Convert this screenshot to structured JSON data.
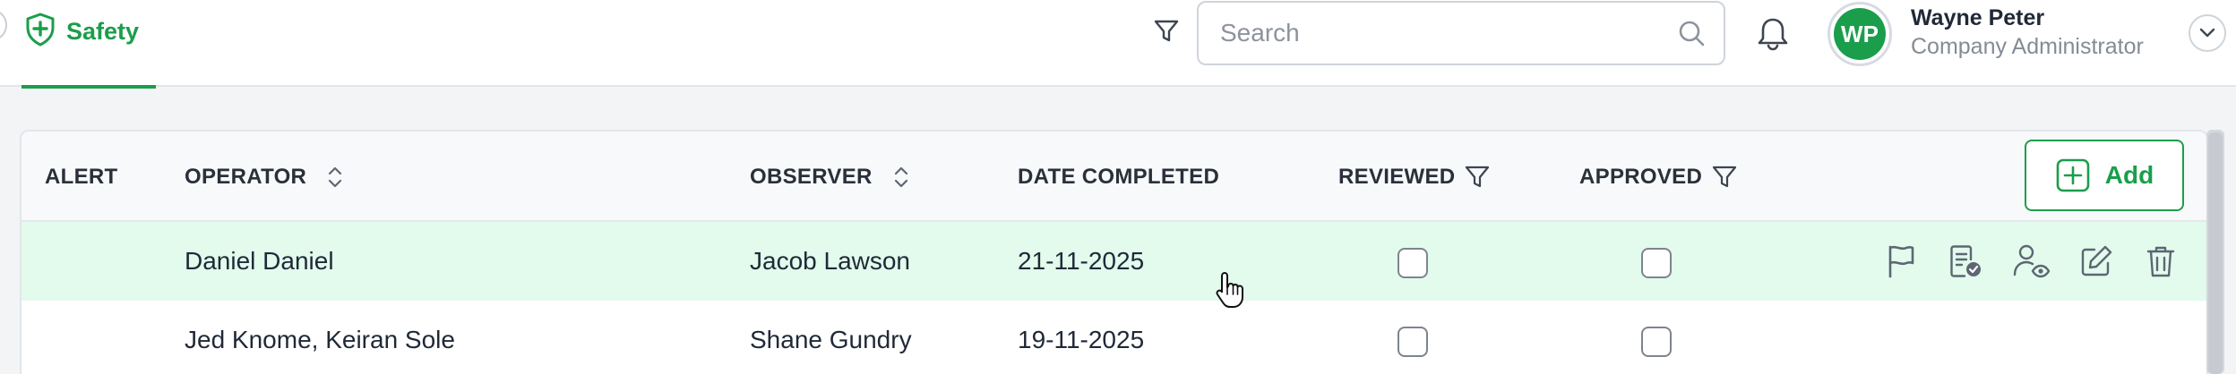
{
  "header": {
    "tab_label": "Safety",
    "search_placeholder": "Search",
    "search_value": "",
    "user": {
      "initials": "WP",
      "name": "Wayne Peter",
      "role": "Company Administrator"
    }
  },
  "table": {
    "columns": {
      "alert": "ALERT",
      "operator": "OPERATOR",
      "observer": "OBSERVER",
      "date_completed": "DATE COMPLETED",
      "reviewed": "REVIEWED",
      "approved": "APPROVED"
    },
    "add_label": "Add",
    "rows": [
      {
        "alert": "",
        "operator": "Daniel Daniel",
        "observer": "Jacob Lawson",
        "date_completed": "21-11-2025",
        "reviewed": false,
        "approved": false
      },
      {
        "alert": "",
        "operator": "Jed Knome, Keiran Sole",
        "observer": "Shane Gundry",
        "date_completed": "19-11-2025",
        "reviewed": false,
        "approved": false
      }
    ]
  },
  "colors": {
    "accent": "#1a9e4b",
    "row_hover": "#e2fbec",
    "icon_gray": "#5d6672"
  },
  "icons": {
    "tab": "shield-plus-icon",
    "filter": "filter-icon",
    "search": "search-icon",
    "notifications": "bell-icon",
    "user_menu": "chevron-down-icon",
    "sort": "sort-icon",
    "add": "plus-square-icon",
    "row_actions": [
      "flag-icon",
      "document-check-icon",
      "user-view-icon",
      "edit-icon",
      "trash-icon"
    ]
  }
}
